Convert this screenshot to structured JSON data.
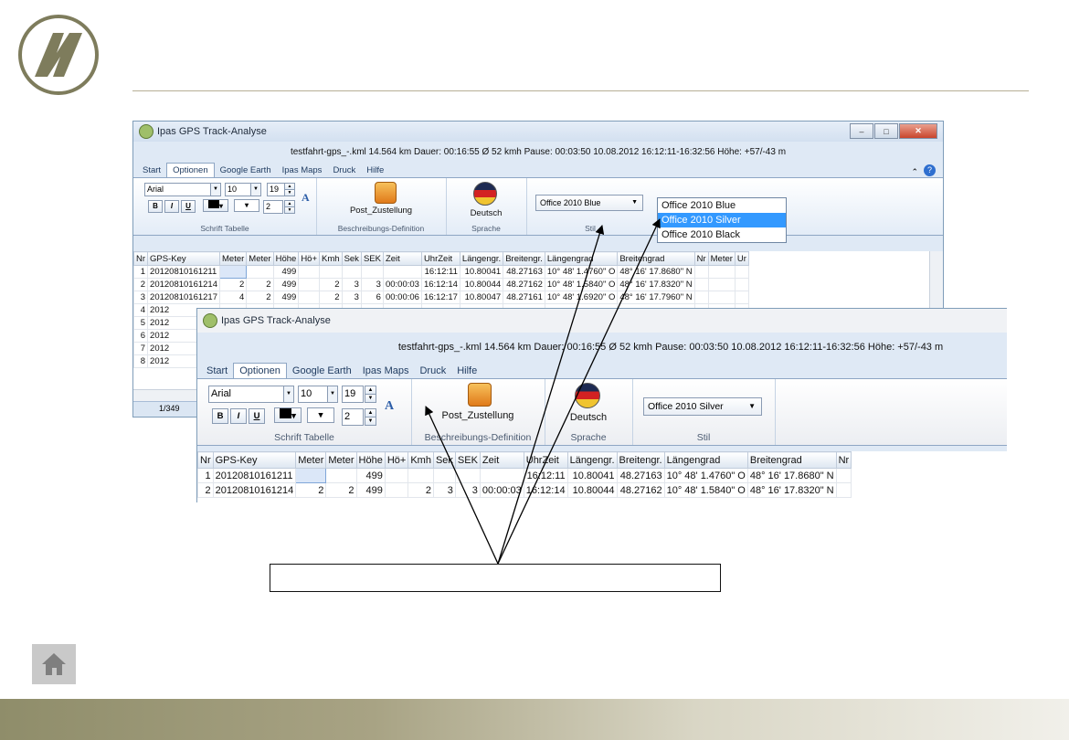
{
  "brand": {
    "logo_icon": "company-logo-mark",
    "line_color": "#b6ae96"
  },
  "window1": {
    "title": "Ipas GPS Track-Analyse",
    "info": "testfahrt-gps_-.kml  14.564 km  Dauer: 00:16:55  Ø 52 kmh  Pause: 00:03:50  10.08.2012 16:12:11-16:32:56   Höhe: +57/-43 m",
    "tabs": [
      "Start",
      "Optionen",
      "Google Earth",
      "Ipas Maps",
      "Druck",
      "Hilfe"
    ],
    "active_tab": "Optionen",
    "font_name": "Arial",
    "font_size": "10",
    "row_height": "19",
    "line_width": "2",
    "bold": "B",
    "italic": "I",
    "underline": "U",
    "text_a": "A",
    "group_schrift": "Schrift Tabelle",
    "post_label": "Post_Zustellung",
    "group_beschreibung": "Beschreibungs-Definition",
    "lang_label": "Deutsch",
    "group_sprache": "Sprache",
    "style_value": "Office 2010 Blue",
    "group_stil": "Stil",
    "columns": [
      "Nr",
      "GPS-Key",
      "Meter",
      "Meter",
      "Höhe",
      "Hö+",
      "Kmh",
      "Sek",
      "SEK",
      "Zeit",
      "UhrZeit",
      "Längengr.",
      "Breitengr.",
      "Längengrad",
      "Breitengrad",
      "Nr",
      "Meter",
      "Ur"
    ],
    "rows": [
      [
        "1",
        "20120810161211",
        "",
        "",
        "499",
        "",
        "",
        "",
        "",
        "",
        "16:12:11",
        "10.80041",
        "48.27163",
        "10° 48' 1.4760\" O",
        "48° 16' 17.8680\" N",
        "",
        "",
        ""
      ],
      [
        "2",
        "20120810161214",
        "2",
        "2",
        "499",
        "",
        "2",
        "3",
        "3",
        "00:00:03",
        "16:12:14",
        "10.80044",
        "48.27162",
        "10° 48' 1.5840\" O",
        "48° 16' 17.8320\" N",
        "",
        "",
        ""
      ],
      [
        "3",
        "20120810161217",
        "4",
        "2",
        "499",
        "",
        "2",
        "3",
        "6",
        "00:00:06",
        "16:12:17",
        "10.80047",
        "48.27161",
        "10° 48' 1.6920\" O",
        "48° 16' 17.7960\" N",
        "",
        "",
        ""
      ]
    ],
    "partial_keys": [
      "2012",
      "2012",
      "2012",
      "2012",
      "2012"
    ],
    "partial_nrs": [
      "4",
      "5",
      "6",
      "7",
      "8"
    ],
    "status": "1/349"
  },
  "dropdown": {
    "options": [
      "Office 2010 Blue",
      "Office 2010 Silver",
      "Office 2010 Black"
    ],
    "highlighted": "Office 2010 Silver",
    "highlight_color": "#3399ff"
  },
  "window2": {
    "title": "Ipas GPS Track-Analyse",
    "info": "testfahrt-gps_-.kml  14.564 km  Dauer: 00:16:55  Ø 52 kmh  Pause: 00:03:50  10.08.2012 16:12:11-16:32:56   Höhe: +57/-43 m",
    "tabs": [
      "Start",
      "Optionen",
      "Google Earth",
      "Ipas Maps",
      "Druck",
      "Hilfe"
    ],
    "active_tab": "Optionen",
    "font_name": "Arial",
    "font_size": "10",
    "row_height": "19",
    "line_width": "2",
    "bold": "B",
    "italic": "I",
    "underline": "U",
    "text_a": "A",
    "group_schrift": "Schrift Tabelle",
    "post_label": "Post_Zustellung",
    "group_beschreibung": "Beschreibungs-Definition",
    "lang_label": "Deutsch",
    "group_sprache": "Sprache",
    "style_value": "Office 2010 Silver",
    "group_stil": "Stil",
    "columns": [
      "Nr",
      "GPS-Key",
      "Meter",
      "Meter",
      "Höhe",
      "Hö+",
      "Kmh",
      "Sek",
      "SEK",
      "Zeit",
      "UhrZeit",
      "Längengr.",
      "Breitengr.",
      "Längengrad",
      "Breitengrad",
      "Nr"
    ],
    "rows": [
      [
        "1",
        "20120810161211",
        "",
        "",
        "499",
        "",
        "",
        "",
        "",
        "",
        "16:12:11",
        "10.80041",
        "48.27163",
        "10° 48' 1.4760\" O",
        "48° 16' 17.8680\" N",
        ""
      ],
      [
        "2",
        "20120810161214",
        "2",
        "2",
        "499",
        "",
        "2",
        "3",
        "3",
        "00:00:03",
        "16:12:14",
        "10.80044",
        "48.27162",
        "10° 48' 1.5840\" O",
        "48° 16' 17.8320\" N",
        ""
      ]
    ]
  },
  "callout": {
    "text": ""
  },
  "home_icon": "home-icon"
}
